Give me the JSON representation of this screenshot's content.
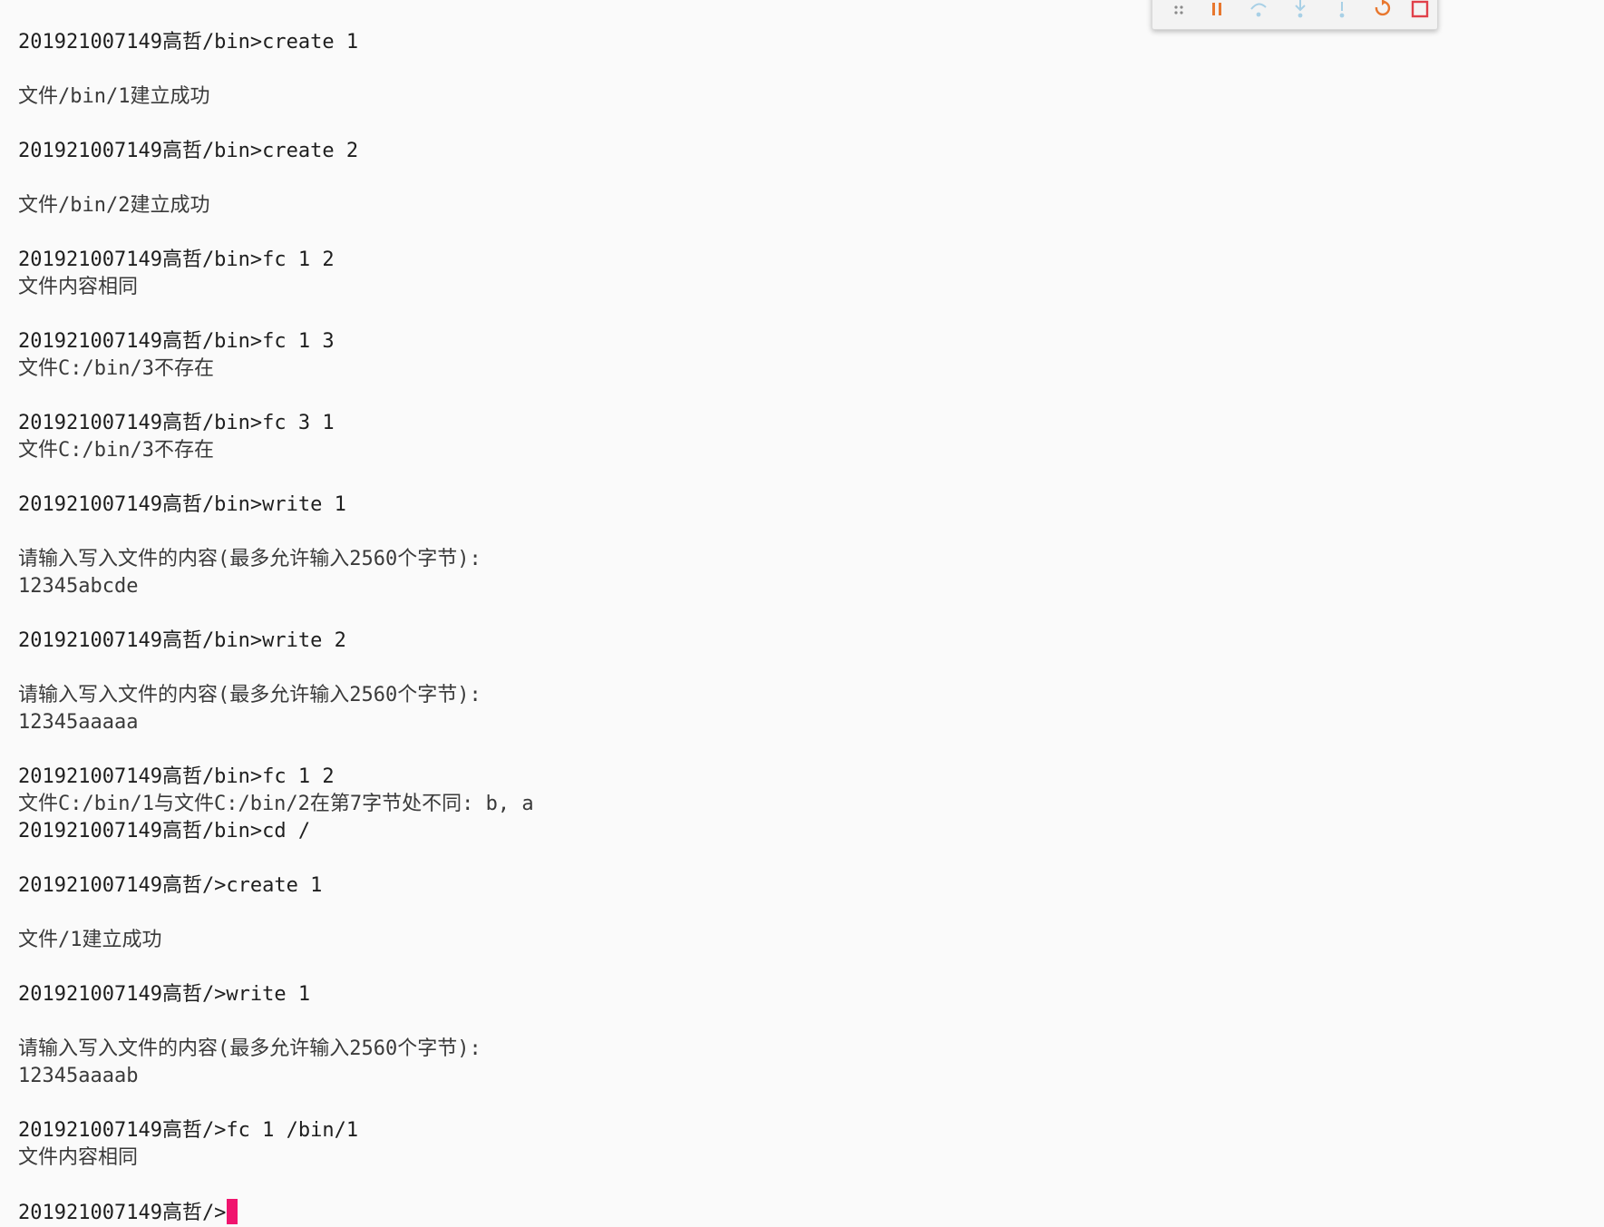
{
  "terminal": {
    "lines": [
      "201921007149高哲/bin>create 1",
      "文件/bin/1建立成功",
      "201921007149高哲/bin>create 2",
      "文件/bin/2建立成功",
      "201921007149高哲/bin>fc 1 2",
      "文件内容相同",
      "201921007149高哲/bin>fc 1 3",
      "文件C:/bin/3不存在",
      "201921007149高哲/bin>fc 3 1",
      "文件C:/bin/3不存在",
      "201921007149高哲/bin>write 1",
      "请输入写入文件的内容(最多允许输入2560个字节):",
      "12345abcde",
      "201921007149高哲/bin>write 2",
      "请输入写入文件的内容(最多允许输入2560个字节):",
      "12345aaaaa",
      "201921007149高哲/bin>fc 1 2",
      "文件C:/bin/1与文件C:/bin/2在第7字节处不同: b, a",
      "201921007149高哲/bin>cd /",
      "201921007149高哲/>create 1",
      "文件/1建立成功",
      "201921007149高哲/>write 1",
      "请输入写入文件的内容(最多允许输入2560个字节):",
      "12345aaaab",
      "201921007149高哲/>fc 1 /bin/1",
      "文件内容相同"
    ],
    "prompt": "201921007149高哲/>"
  },
  "toolbar": {
    "icons": [
      "drag-handle-icon",
      "pause-icon",
      "step-over-icon",
      "step-into-icon",
      "step-out-icon",
      "restart-icon",
      "stop-icon"
    ]
  },
  "colors": {
    "background": "#fafafa",
    "text": "#2f2f2f",
    "cursor": "#f0146e",
    "restart": "#e8772e",
    "stop": "#e0404a",
    "pause": "#e8772e",
    "step": "#7fb8d8"
  }
}
